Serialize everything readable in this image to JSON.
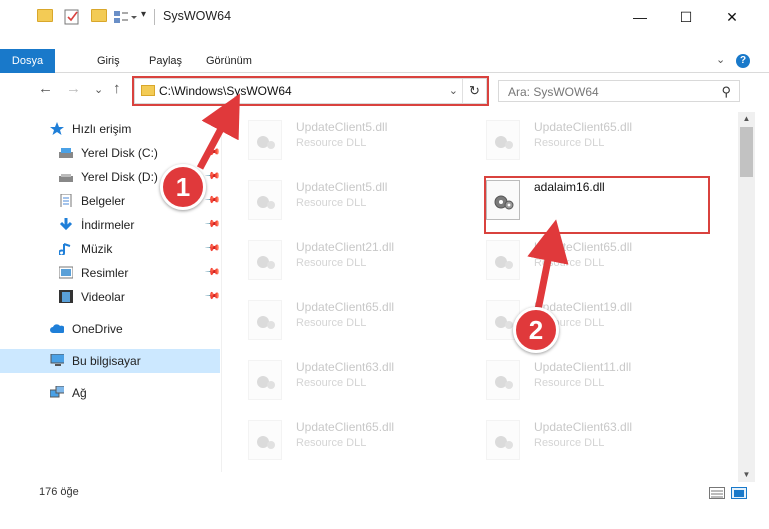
{
  "window": {
    "title": "SysWOW64",
    "minimize": "—",
    "maximize": "☐",
    "close": "✕"
  },
  "quick_access_toolbar": {
    "dropdown": "▾"
  },
  "ribbon": {
    "tabs": [
      "Dosya",
      "Giriş",
      "Paylaş",
      "Görünüm"
    ],
    "expand": "⌄",
    "help": "?"
  },
  "nav": {
    "back": "←",
    "forward": "→",
    "recent": "⌄",
    "up": "↑",
    "address": "C:\\Windows\\SysWOW64",
    "address_dropdown": "⌄",
    "refresh": "↻",
    "search_placeholder": "Ara: SysWOW64",
    "search_icon": "⚲"
  },
  "sidebar": {
    "items": [
      {
        "label": "Hızlı erişim",
        "icon": "star-icon"
      },
      {
        "label": "Yerel Disk (C:)",
        "icon": "drive-icon",
        "pinned": true
      },
      {
        "label": "Yerel Disk (D:)",
        "icon": "drive-icon",
        "pinned": true
      },
      {
        "label": "Belgeler",
        "icon": "documents-icon",
        "pinned": true
      },
      {
        "label": "İndirmeler",
        "icon": "download-icon",
        "pinned": true
      },
      {
        "label": "Müzik",
        "icon": "music-icon",
        "pinned": true
      },
      {
        "label": "Resimler",
        "icon": "pictures-icon",
        "pinned": true
      },
      {
        "label": "Videolar",
        "icon": "videos-icon",
        "pinned": true
      },
      {
        "label": "OneDrive",
        "icon": "cloud-icon"
      },
      {
        "label": "Bu bilgisayar",
        "icon": "computer-icon",
        "selected": true
      },
      {
        "label": "Ağ",
        "icon": "network-icon"
      }
    ]
  },
  "files": {
    "left": [
      {
        "name": "UpdateClient5.dll",
        "type": "Resource DLL"
      },
      {
        "name": "UpdateClient5.dll",
        "type": "Resource DLL"
      },
      {
        "name": "UpdateClient21.dll",
        "type": "Resource DLL"
      },
      {
        "name": "UpdateClient65.dll",
        "type": "Resource DLL"
      },
      {
        "name": "UpdateClient63.dll",
        "type": "Resource DLL"
      },
      {
        "name": "UpdateClient65.dll",
        "type": "Resource DLL"
      }
    ],
    "right": [
      {
        "name": "UpdateClient65.dll",
        "type": "Resource DLL"
      },
      {
        "name": "adalaim16.dll",
        "type": "",
        "highlighted": true
      },
      {
        "name": "UpdateClient65.dll",
        "type": "Resource DLL"
      },
      {
        "name": "UpdateClient19.dll",
        "type": "Resource DLL"
      },
      {
        "name": "UpdateClient11.dll",
        "type": "Resource DLL"
      },
      {
        "name": "UpdateClient63.dll",
        "type": "Resource DLL"
      }
    ]
  },
  "status": {
    "count": "176 öğe"
  },
  "annotations": {
    "step1": "1",
    "step2": "2",
    "color": "#e0393b"
  }
}
